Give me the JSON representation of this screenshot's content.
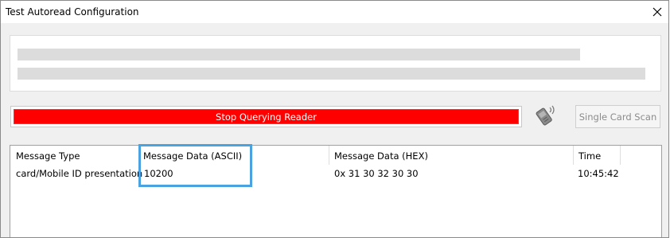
{
  "window": {
    "title": "Test Autoread Configuration"
  },
  "controls": {
    "stop_label": "Stop Querying Reader",
    "scan_label": "Single Card Scan",
    "stop_color": "#ff0000",
    "scan_enabled": false
  },
  "table": {
    "columns": [
      "Message Type",
      "Message Data (ASCII)",
      "Message Data (HEX)",
      "Time"
    ],
    "rows": [
      [
        "card/Mobile ID presentation",
        "10200",
        "0x 31 30 32 30 30",
        "10:45:42"
      ]
    ],
    "highlighted_column": "Message Data (ASCII)",
    "highlight_color": "#4aa3df"
  },
  "icons": {
    "close": "close-icon",
    "reader": "card-reader-icon"
  }
}
